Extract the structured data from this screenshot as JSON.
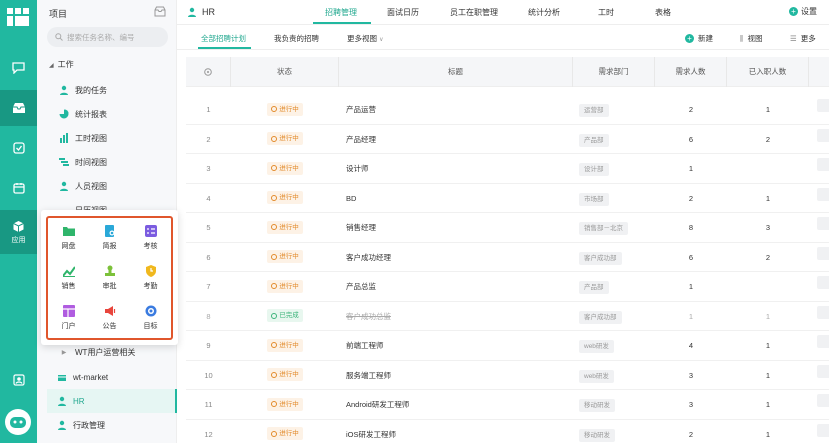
{
  "sidebar": {
    "title": "项目",
    "search_placeholder": "搜索任务名称、编号",
    "section": "工作",
    "items": [
      {
        "label": "我的任务",
        "icon": "user-icon"
      },
      {
        "label": "统计报表",
        "icon": "pie-chart-icon"
      },
      {
        "label": "工时视图",
        "icon": "bar-chart-icon"
      },
      {
        "label": "时间视图",
        "icon": "timeline-icon"
      },
      {
        "label": "人员视图",
        "icon": "user-icon"
      }
    ],
    "partial_item": "日历视图",
    "projects": [
      {
        "label": "WT用户运营相关",
        "icon": "folder-icon"
      },
      {
        "label": "wt-market",
        "icon": "cloud-icon"
      },
      {
        "label": "HR",
        "icon": "user-icon",
        "active": true
      },
      {
        "label": "行政管理",
        "icon": "user-icon"
      }
    ]
  },
  "rail": {
    "app_label": "应用"
  },
  "apps_popup": {
    "apps": [
      {
        "label": "网盘",
        "icon": "folder-icon",
        "color": "#2fb56b"
      },
      {
        "label": "简报",
        "icon": "report-icon",
        "color": "#2aa8d8"
      },
      {
        "label": "考核",
        "icon": "checklist-icon",
        "color": "#7b5ce0"
      },
      {
        "label": "销售",
        "icon": "trend-icon",
        "color": "#2fb56b"
      },
      {
        "label": "审批",
        "icon": "stamp-icon",
        "color": "#7cc13a"
      },
      {
        "label": "考勤",
        "icon": "shield-icon",
        "color": "#f0b81e"
      },
      {
        "label": "门户",
        "icon": "portal-icon",
        "color": "#b05ce0"
      },
      {
        "label": "公告",
        "icon": "megaphone-icon",
        "color": "#e8453c"
      },
      {
        "label": "目标",
        "icon": "target-icon",
        "color": "#3a7be0"
      }
    ]
  },
  "header": {
    "title": "HR",
    "tabs": [
      "招聘管理",
      "面试日历",
      "员工在职管理",
      "统计分析",
      "工时",
      "表格"
    ],
    "settings": "设置"
  },
  "subheader": {
    "tabs": [
      "全部招聘计划",
      "我负责的招聘",
      "更多视图"
    ],
    "actions": [
      "新建",
      "视图",
      "更多"
    ]
  },
  "table": {
    "columns": [
      "状态",
      "标题",
      "需求部门",
      "需求人数",
      "已入职人数"
    ],
    "rows": [
      {
        "idx": "1",
        "status": "进行中",
        "title": "产品运营",
        "dept": "运营部",
        "need": "2",
        "hired": "1"
      },
      {
        "idx": "2",
        "status": "进行中",
        "title": "产品经理",
        "dept": "产品部",
        "need": "6",
        "hired": "2"
      },
      {
        "idx": "3",
        "status": "进行中",
        "title": "设计师",
        "dept": "设计部",
        "need": "1",
        "hired": ""
      },
      {
        "idx": "4",
        "status": "进行中",
        "title": "BD",
        "dept": "市场部",
        "need": "2",
        "hired": "1"
      },
      {
        "idx": "5",
        "status": "进行中",
        "title": "销售经理",
        "dept": "销售部－北京",
        "need": "8",
        "hired": "3"
      },
      {
        "idx": "6",
        "status": "进行中",
        "title": "客户成功经理",
        "dept": "客户成功部",
        "need": "6",
        "hired": "2"
      },
      {
        "idx": "7",
        "status": "进行中",
        "title": "产品总监",
        "dept": "产品部",
        "need": "1",
        "hired": ""
      },
      {
        "idx": "8",
        "status": "已完成",
        "title": "客户成功总监",
        "dept": "客户成功部",
        "need": "1",
        "hired": "1"
      },
      {
        "idx": "9",
        "status": "进行中",
        "title": "前端工程师",
        "dept": "web研发",
        "need": "4",
        "hired": "1"
      },
      {
        "idx": "10",
        "status": "进行中",
        "title": "服务端工程师",
        "dept": "web研发",
        "need": "3",
        "hired": "1"
      },
      {
        "idx": "11",
        "status": "进行中",
        "title": "Android研发工程师",
        "dept": "移动研发",
        "need": "3",
        "hired": "1"
      },
      {
        "idx": "12",
        "status": "进行中",
        "title": "iOS研发工程师",
        "dept": "移动研发",
        "need": "2",
        "hired": "1"
      }
    ]
  },
  "colors": {
    "accent": "#21b8a0",
    "running": "#e28a2a",
    "done": "#3bb37a",
    "highlight_border": "#e0562c"
  }
}
